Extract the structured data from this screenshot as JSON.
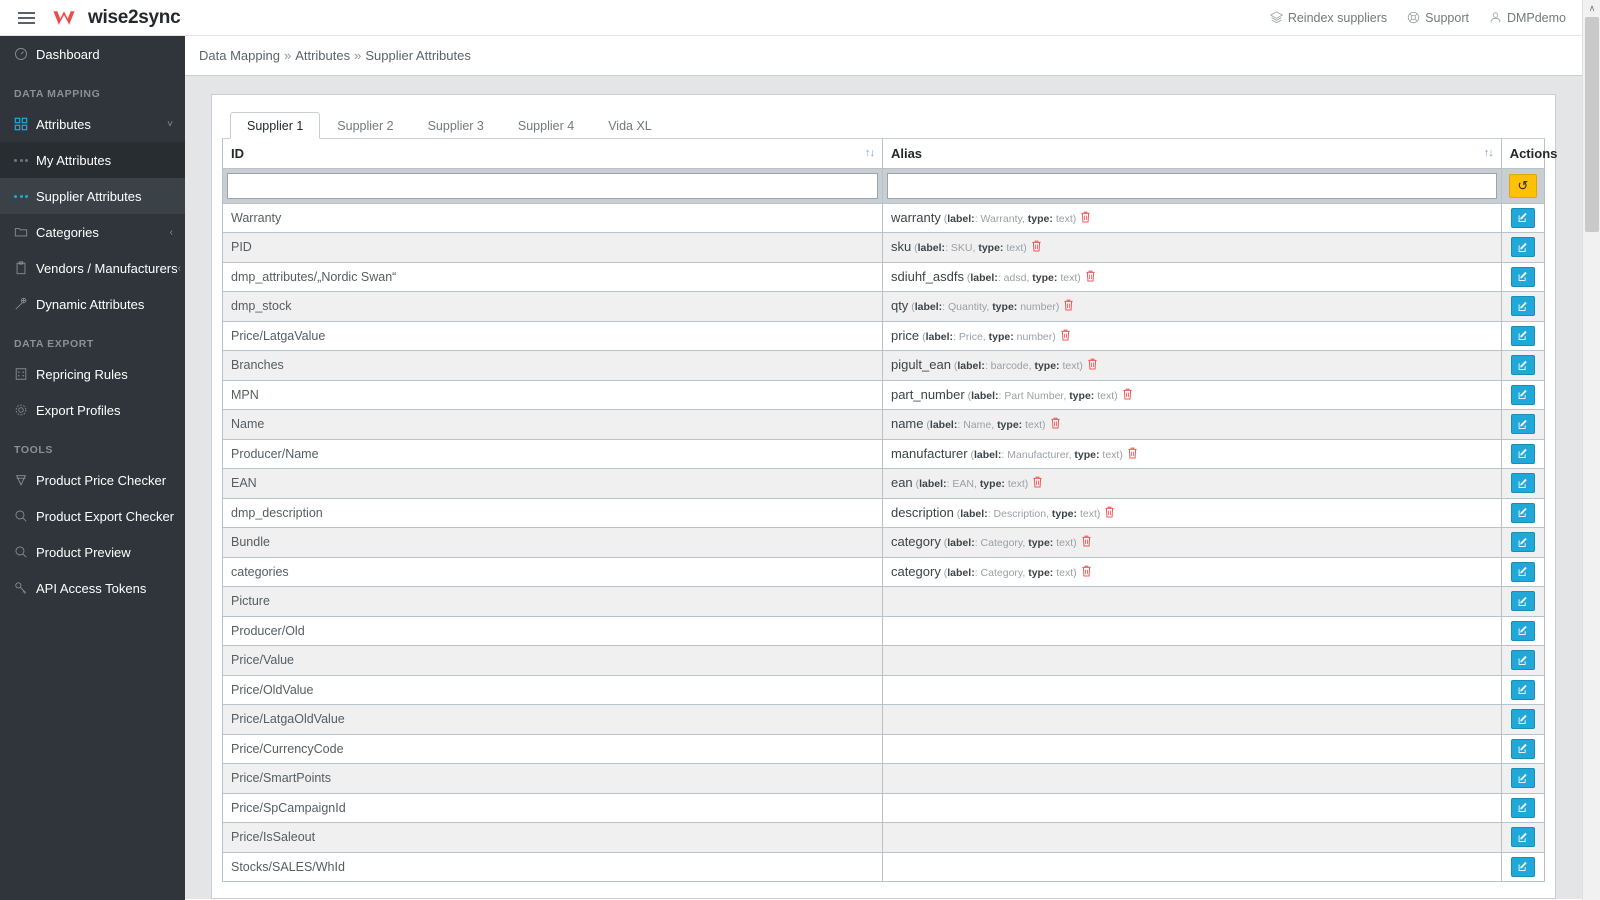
{
  "brand": {
    "name": "wise2sync",
    "accent": "#ef4b4b"
  },
  "topbar": {
    "menu_icon": "hamburger-icon",
    "links": [
      {
        "label": "Reindex suppliers",
        "icon": "layers-icon"
      },
      {
        "label": "Support",
        "icon": "lifebuoy-icon"
      },
      {
        "label": "DMPdemo",
        "icon": "user-icon"
      }
    ]
  },
  "sidebar": {
    "dashboard": {
      "label": "Dashboard",
      "icon": "speedometer-icon"
    },
    "sections": [
      {
        "title": "DATA MAPPING",
        "items": [
          {
            "label": "Attributes",
            "icon": "grid-icon",
            "caret": "˅",
            "state": "expanded"
          },
          {
            "label": "My Attributes",
            "icon": "dots-icon",
            "sub": true,
            "state": "normal"
          },
          {
            "label": "Supplier Attributes",
            "icon": "dots-icon",
            "sub": true,
            "state": "selected"
          },
          {
            "label": "Categories",
            "icon": "folder-icon",
            "caret": "‹"
          },
          {
            "label": "Vendors / Manufacturers",
            "icon": "clipboard-icon",
            "caret": "‹"
          },
          {
            "label": "Dynamic Attributes",
            "icon": "magic-wand-icon"
          }
        ]
      },
      {
        "title": "DATA EXPORT",
        "items": [
          {
            "label": "Repricing Rules",
            "icon": "calculator-icon"
          },
          {
            "label": "Export Profiles",
            "icon": "gear-icon"
          }
        ]
      },
      {
        "title": "TOOLS",
        "items": [
          {
            "label": "Product Price Checker",
            "icon": "diamond-icon"
          },
          {
            "label": "Product Export Checker",
            "icon": "search-icon"
          },
          {
            "label": "Product Preview",
            "icon": "search-icon"
          },
          {
            "label": "API Access Tokens",
            "icon": "key-icon"
          }
        ]
      }
    ]
  },
  "breadcrumb": {
    "items": [
      "Data Mapping",
      "Attributes",
      "Supplier Attributes"
    ],
    "separator": "»"
  },
  "tabs": [
    {
      "label": "Supplier 1",
      "active": true
    },
    {
      "label": "Supplier 2",
      "active": false
    },
    {
      "label": "Supplier 3",
      "active": false
    },
    {
      "label": "Supplier 4",
      "active": false
    },
    {
      "label": "Vida XL",
      "active": false
    }
  ],
  "table": {
    "columns": [
      {
        "key": "id",
        "label": "ID",
        "sortable": true,
        "sort_icon": "↑↓"
      },
      {
        "key": "alias",
        "label": "Alias",
        "sortable": true,
        "sort_icon": "↑↓"
      },
      {
        "key": "actions",
        "label": "Actions",
        "sortable": false
      }
    ],
    "filter_row": {
      "id_value": "",
      "id_placeholder": "",
      "alias_value": "",
      "alias_placeholder": "",
      "reset_icon": "↺",
      "reset_title": "Reset"
    },
    "meta_labels": {
      "label_key": "label:",
      "type_key": "type:",
      "separator": ":"
    },
    "trash_icon": "🗑",
    "edit_icon": "edit-icon",
    "rows": [
      {
        "id": "Warranty",
        "alias": "warranty",
        "label": "Warranty",
        "type": "text",
        "has_alias": true
      },
      {
        "id": "PID",
        "alias": "sku",
        "label": "SKU",
        "type": "text",
        "has_alias": true
      },
      {
        "id": "dmp_attributes/„Nordic Swan“",
        "alias": "sdiuhf_asdfs",
        "label": "adsd",
        "type": "text",
        "has_alias": true
      },
      {
        "id": "dmp_stock",
        "alias": "qty",
        "label": "Quantity",
        "type": "number",
        "has_alias": true
      },
      {
        "id": "Price/LatgaValue",
        "alias": "price",
        "label": "Price",
        "type": "number",
        "has_alias": true
      },
      {
        "id": "Branches",
        "alias": "pigult_ean",
        "label": "barcode",
        "type": "text",
        "has_alias": true
      },
      {
        "id": "MPN",
        "alias": "part_number",
        "label": "Part Number",
        "type": "text",
        "has_alias": true
      },
      {
        "id": "Name",
        "alias": "name",
        "label": "Name",
        "type": "text",
        "has_alias": true
      },
      {
        "id": "Producer/Name",
        "alias": "manufacturer",
        "label": "Manufacturer",
        "type": "text",
        "has_alias": true
      },
      {
        "id": "EAN",
        "alias": "ean",
        "label": "EAN",
        "type": "text",
        "has_alias": true
      },
      {
        "id": "dmp_description",
        "alias": "description",
        "label": "Description",
        "type": "text",
        "has_alias": true
      },
      {
        "id": "Bundle",
        "alias": "category",
        "label": "Category",
        "type": "text",
        "has_alias": true
      },
      {
        "id": "categories",
        "alias": "category",
        "label": "Category",
        "type": "text",
        "has_alias": true
      },
      {
        "id": "Picture",
        "alias": "",
        "label": "",
        "type": "",
        "has_alias": false
      },
      {
        "id": "Producer/Old",
        "alias": "",
        "label": "",
        "type": "",
        "has_alias": false
      },
      {
        "id": "Price/Value",
        "alias": "",
        "label": "",
        "type": "",
        "has_alias": false
      },
      {
        "id": "Price/OldValue",
        "alias": "",
        "label": "",
        "type": "",
        "has_alias": false
      },
      {
        "id": "Price/LatgaOldValue",
        "alias": "",
        "label": "",
        "type": "",
        "has_alias": false
      },
      {
        "id": "Price/CurrencyCode",
        "alias": "",
        "label": "",
        "type": "",
        "has_alias": false
      },
      {
        "id": "Price/SmartPoints",
        "alias": "",
        "label": "",
        "type": "",
        "has_alias": false
      },
      {
        "id": "Price/SpCampaignId",
        "alias": "",
        "label": "",
        "type": "",
        "has_alias": false
      },
      {
        "id": "Price/IsSaleout",
        "alias": "",
        "label": "",
        "type": "",
        "has_alias": false
      },
      {
        "id": "Stocks/SALES/WhId",
        "alias": "",
        "label": "",
        "type": "",
        "has_alias": false
      }
    ]
  },
  "scrollbar": {
    "up_arrow": "∧"
  }
}
